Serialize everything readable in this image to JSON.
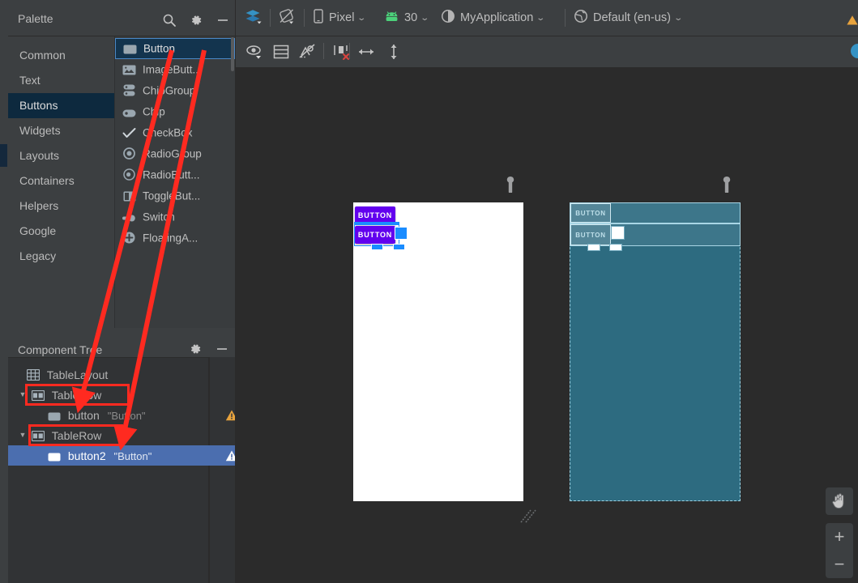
{
  "palette": {
    "title": "Palette",
    "search_icon": "search-icon",
    "settings_icon": "gear-icon",
    "minimize_icon": "minimize-icon",
    "categories": [
      {
        "label": "Common",
        "selected": false
      },
      {
        "label": "Text",
        "selected": false
      },
      {
        "label": "Buttons",
        "selected": true
      },
      {
        "label": "Widgets",
        "selected": false
      },
      {
        "label": "Layouts",
        "selected": false
      },
      {
        "label": "Containers",
        "selected": false
      },
      {
        "label": "Helpers",
        "selected": false
      },
      {
        "label": "Google",
        "selected": false
      },
      {
        "label": "Legacy",
        "selected": false
      }
    ],
    "items": [
      {
        "label": "Button",
        "icon": "button-icon",
        "selected": true
      },
      {
        "label": "ImageButt...",
        "icon": "image-button-icon",
        "selected": false
      },
      {
        "label": "ChipGroup",
        "icon": "chip-group-icon",
        "selected": false
      },
      {
        "label": "Chip",
        "icon": "chip-icon",
        "selected": false
      },
      {
        "label": "CheckBox",
        "icon": "checkbox-icon",
        "selected": false
      },
      {
        "label": "RadioGroup",
        "icon": "radio-group-icon",
        "selected": false
      },
      {
        "label": "RadioButt...",
        "icon": "radio-button-icon",
        "selected": false
      },
      {
        "label": "ToggleBut...",
        "icon": "toggle-button-icon",
        "selected": false
      },
      {
        "label": "Switch",
        "icon": "switch-icon",
        "selected": false
      },
      {
        "label": "FloatingA...",
        "icon": "floating-action-button-icon",
        "selected": false
      }
    ]
  },
  "component_tree": {
    "title": "Component Tree",
    "settings_icon": "gear-icon",
    "minimize_icon": "minimize-icon",
    "nodes": [
      {
        "id": "TableLayout",
        "text": "",
        "icon": "table-layout-icon",
        "indent": 0,
        "arrow": "",
        "selected": false,
        "warning": "none"
      },
      {
        "id": "TableRow",
        "text": "",
        "icon": "table-row-icon",
        "indent": 1,
        "arrow": "▼",
        "selected": false,
        "warning": "none"
      },
      {
        "id": "button",
        "text": "\"Button\"",
        "icon": "button-icon",
        "indent": 2,
        "arrow": "",
        "selected": false,
        "warning": "orange"
      },
      {
        "id": "TableRow",
        "text": "",
        "icon": "table-row-icon",
        "indent": 1,
        "arrow": "▼",
        "selected": false,
        "warning": "none"
      },
      {
        "id": "button2",
        "text": "\"Button\"",
        "icon": "button-icon",
        "indent": 2,
        "arrow": "",
        "selected": true,
        "warning": "white"
      }
    ]
  },
  "toolbar": {
    "design_mode_icon": "layers-icon",
    "orientation_icon": "rotate-device-icon",
    "device": {
      "label": "Pixel",
      "icon": "phone-icon",
      "caret": "⌄"
    },
    "api": {
      "label": "30",
      "icon": "android-icon",
      "caret": "⌄"
    },
    "theme": {
      "label": "MyApplication",
      "icon": "theme-contrast-icon",
      "caret": "⌄"
    },
    "locale": {
      "label": "Default (en-us)",
      "icon": "globe-icon",
      "caret": "⌄"
    }
  },
  "surface_toolbar": {
    "buttons": [
      {
        "name": "view-options-icon",
        "title": "Select Design Surface"
      },
      {
        "name": "layout-decorations-icon",
        "title": "Show Layout Decorations"
      },
      {
        "name": "hide-blueprint-icon",
        "title": "Toggle Blueprint"
      },
      {
        "name": "clear-constraints-icon",
        "title": "Clear All Constraints"
      },
      {
        "name": "horizontal-guideline-icon",
        "title": "Horizontal Align"
      },
      {
        "name": "vertical-guideline-icon",
        "title": "Vertical Align"
      }
    ]
  },
  "canvas": {
    "render_preview": {
      "name": "design-render-preview",
      "wrench_icon": "wrench-icon",
      "background": "#ffffff",
      "buttons": [
        {
          "label": "BUTTON",
          "color": "#6200ee",
          "selected": false
        },
        {
          "label": "BUTTON",
          "color": "#6200ee",
          "selected": true
        }
      ]
    },
    "blueprint_preview": {
      "name": "blueprint-preview",
      "wrench_icon": "wrench-icon",
      "background": "#2d6b80",
      "buttons": [
        {
          "label": "BUTTON",
          "selected": false
        },
        {
          "label": "BUTTON",
          "selected": true
        }
      ]
    },
    "resize_handle_icon": "resize-handle-icon",
    "pan_button_icon": "pan-hand-icon",
    "zoom_in_label": "+",
    "zoom_out_label": "−"
  },
  "indicators": {
    "warning_icon": "warning-triangle-icon",
    "notification_icon": "notification-dot-icon"
  },
  "annotations": {
    "color": "#ff2a20",
    "boxes": [
      {
        "name": "annotation-box-tablerow-1"
      },
      {
        "name": "annotation-box-tablerow-2"
      }
    ],
    "arrows": [
      {
        "name": "annotation-arrow-1"
      },
      {
        "name": "annotation-arrow-2"
      }
    ]
  }
}
